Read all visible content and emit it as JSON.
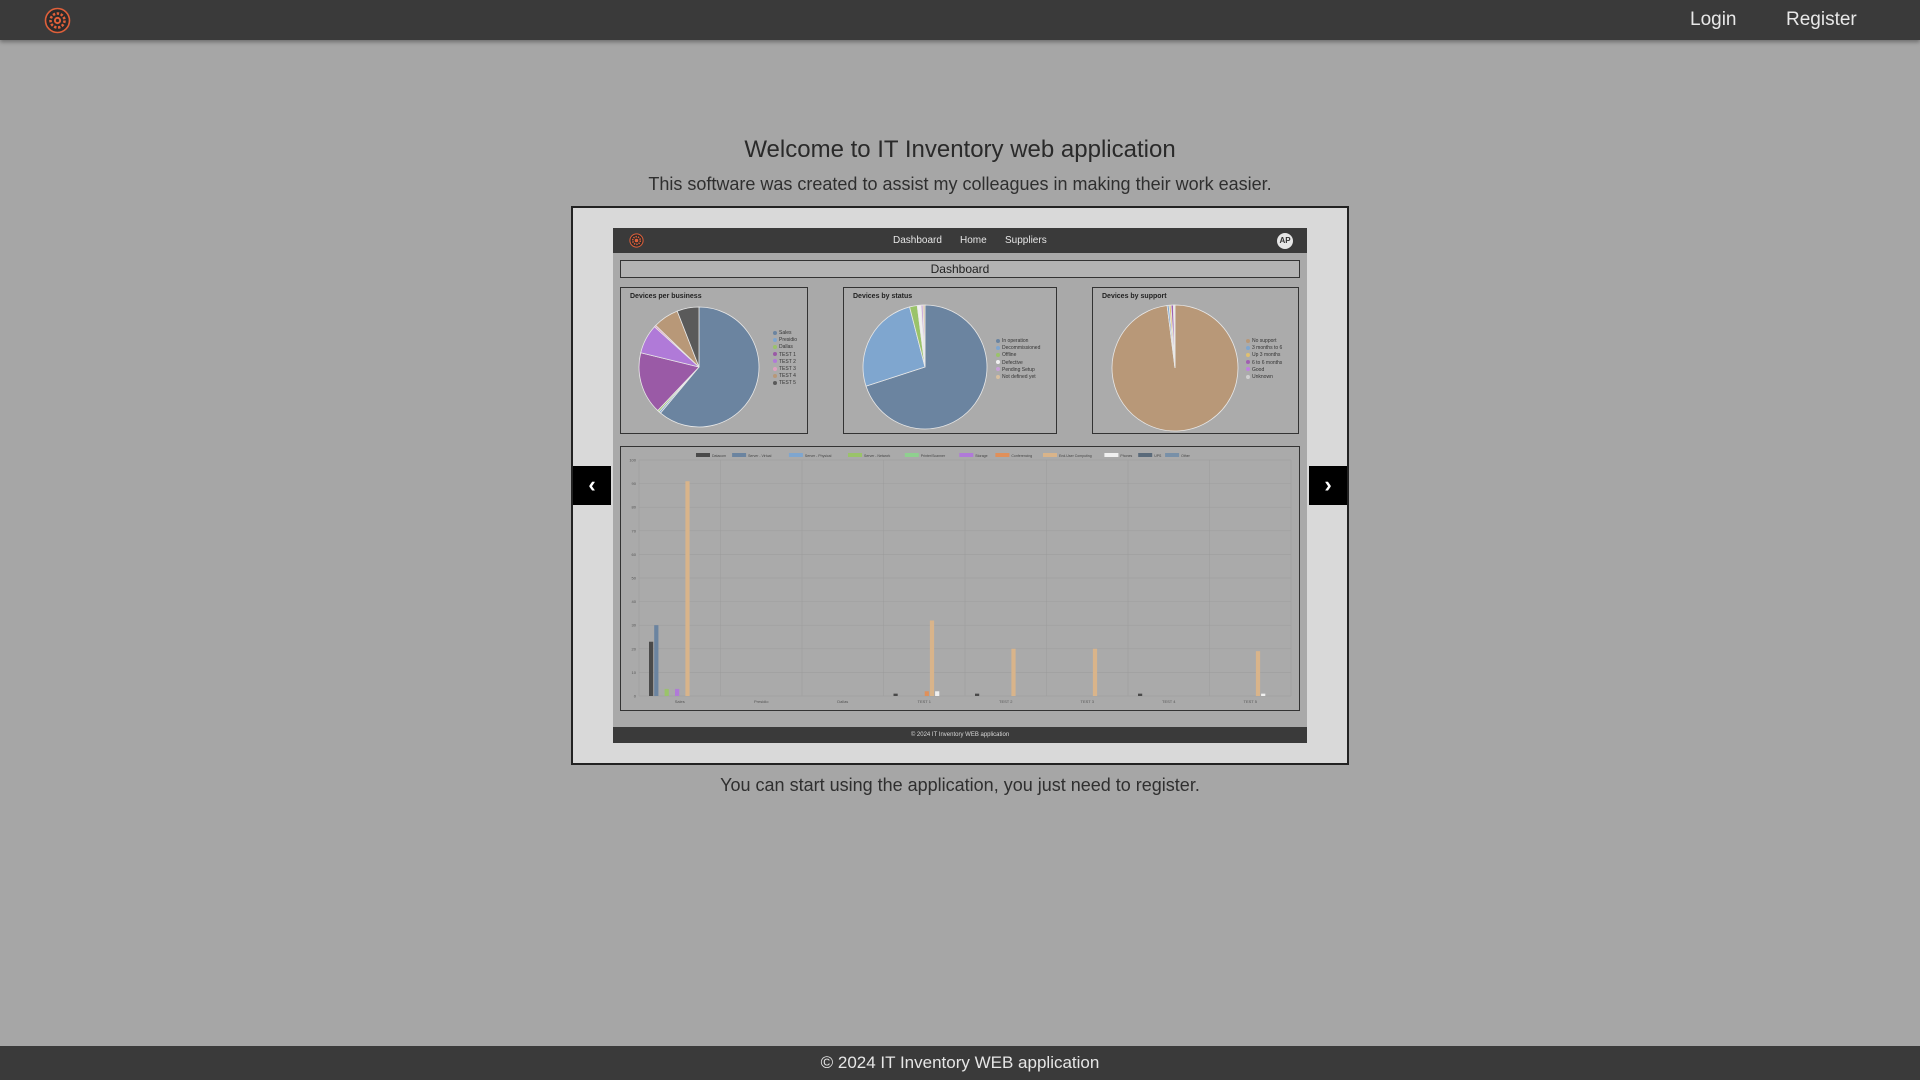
{
  "nav": {
    "login_label": "Login",
    "register_label": "Register",
    "logo_icon": "gear-logo-icon"
  },
  "welcome": {
    "title": "Welcome to IT Inventory web application",
    "subtitle": "This software was created to assist my colleagues in making their work easier."
  },
  "carousel": {
    "prev_label": "‹",
    "next_label": "›",
    "slide": {
      "nav_links": [
        "Dashboard",
        "Home",
        "Suppliers"
      ],
      "avatar": "AP",
      "dashboard_title": "Dashboard",
      "footer": "© 2024 IT Inventory WEB application"
    }
  },
  "register_hint": "You can start using the application, you just need to register.",
  "footer": {
    "copyright": "© 2024 IT Inventory WEB application"
  },
  "colors": {
    "accent": "#e0603a",
    "bar_bg": "#3a3a3a",
    "page_bg": "#a6a6a6"
  },
  "chart_data": [
    {
      "type": "pie",
      "title": "Devices per business",
      "legend": [
        "Sales",
        "Presidio",
        "Dallas",
        "TEST 1",
        "TEST 2",
        "TEST 3",
        "TEST 4",
        "TEST 5"
      ],
      "values": [
        62,
        0.5,
        0.5,
        17,
        8,
        0.5,
        7,
        6
      ],
      "colors": [
        "#6b84a0",
        "#7fa6cf",
        "#9ac36a",
        "#9a5aa6",
        "#b07ad8",
        "#e0a0c0",
        "#b89878",
        "#5a5a5a"
      ]
    },
    {
      "type": "pie",
      "title": "Devices by status",
      "legend": [
        "In operation",
        "Decommissioned",
        "Offline",
        "Defective",
        "Pending Setup",
        "Not defined yet"
      ],
      "values": [
        70,
        26,
        2,
        1,
        0.5,
        0.5
      ],
      "colors": [
        "#6b84a0",
        "#7fa6cf",
        "#9ac36a",
        "#f0f0f0",
        "#c9a0d8",
        "#d8c0a0"
      ]
    },
    {
      "type": "pie",
      "title": "Devices by support",
      "legend": [
        "No support",
        "3 months to 6",
        "Up 3 months",
        "6 to 6 months",
        "Good",
        "Unknown"
      ],
      "values": [
        98,
        0.5,
        0.5,
        0.6,
        0.2,
        0.2
      ],
      "colors": [
        "#b89878",
        "#7fa6cf",
        "#e0c070",
        "#a060b0",
        "#c080e0",
        "#d0d0d0"
      ]
    },
    {
      "type": "bar",
      "categories": [
        "Sales",
        "Presidio",
        "Dallas",
        "TEST 1",
        "TEST 2",
        "TEST 3",
        "TEST 4",
        "TEST 5"
      ],
      "series": [
        {
          "name": "Datacom",
          "values": [
            23,
            0,
            0,
            1,
            1,
            0,
            1,
            0
          ]
        },
        {
          "name": "Server - Virtual",
          "values": [
            30,
            0,
            0,
            0,
            0,
            0,
            0,
            0
          ]
        },
        {
          "name": "Server - Physical",
          "values": [
            0,
            0,
            0,
            0,
            0,
            0,
            0,
            0
          ]
        },
        {
          "name": "Server - Network",
          "values": [
            3,
            0,
            0,
            0,
            0,
            0,
            0,
            0
          ]
        },
        {
          "name": "Printer/Scanner",
          "values": [
            0,
            0,
            0,
            0,
            0,
            0,
            0,
            0
          ]
        },
        {
          "name": "Storage",
          "values": [
            3,
            0,
            0,
            0,
            0,
            0,
            0,
            0
          ]
        },
        {
          "name": "Conferencing",
          "values": [
            0,
            0,
            0,
            2,
            0,
            0,
            0,
            0
          ]
        },
        {
          "name": "End-User Computing",
          "values": [
            91,
            0,
            0,
            32,
            20,
            20,
            0,
            19
          ]
        },
        {
          "name": "Phones",
          "values": [
            0,
            0,
            0,
            2,
            0,
            0,
            0,
            1
          ]
        },
        {
          "name": "UPS",
          "values": [
            0,
            0,
            0,
            0,
            0,
            0,
            0,
            0
          ]
        },
        {
          "name": "Other",
          "values": [
            0,
            0,
            0,
            0,
            0,
            0,
            0,
            0
          ]
        }
      ],
      "colors": [
        "#4a4a4a",
        "#6b84a0",
        "#7fa6cf",
        "#9ac36a",
        "#8fd08f",
        "#b07ad8",
        "#e0905a",
        "#d9b48a",
        "#f0f0f0",
        "#5a6a7a",
        "#7890a8"
      ],
      "ylim": [
        0,
        100
      ]
    }
  ]
}
